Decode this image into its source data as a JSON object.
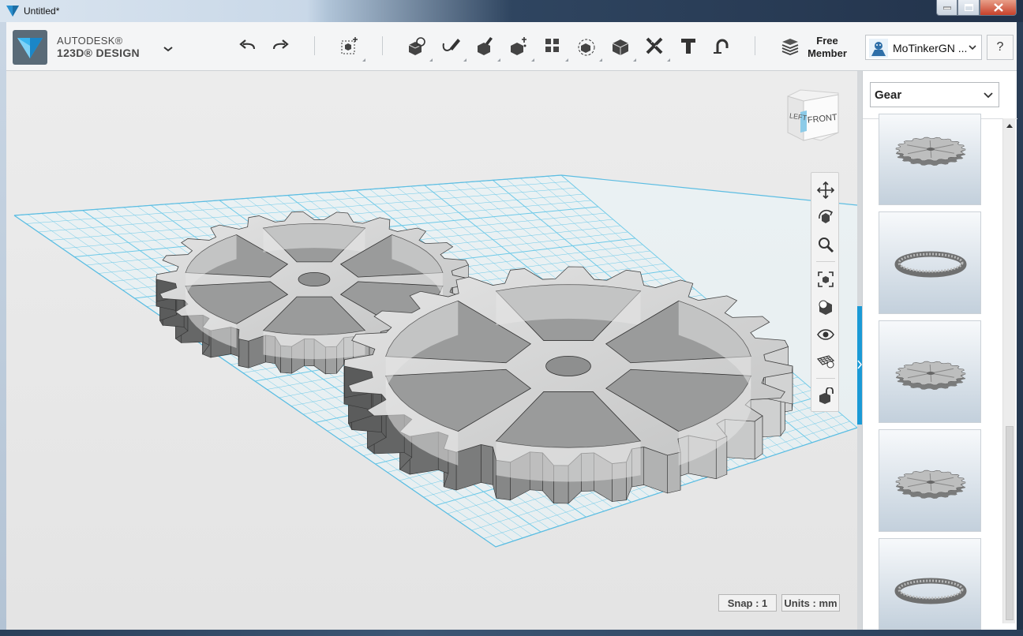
{
  "window": {
    "title": "Untitled*"
  },
  "brand": {
    "line1": "AUTODESK®",
    "line2": "123D® DESIGN"
  },
  "toolbar": {
    "icons": [
      "undo-icon",
      "redo-icon",
      "transform-icon",
      "primitives-icon",
      "sketch-icon",
      "construct-icon",
      "modify-icon",
      "pattern-icon",
      "group-icon",
      "combine-icon",
      "measure-icon",
      "text-icon",
      "snap-icon",
      "material-icon"
    ]
  },
  "account": {
    "membership": "Free\nMember",
    "membership_l1": "Free",
    "membership_l2": "Member",
    "username": "MoTinkerGN ...",
    "help": "?"
  },
  "viewcube": {
    "left": "LEFT",
    "front": "FRONT"
  },
  "navbar": {
    "icons": [
      "pan-icon",
      "orbit-icon",
      "zoom-icon",
      "fit-icon",
      "view-icon",
      "visibility-icon",
      "grid-icon",
      "material-icon"
    ]
  },
  "status": {
    "snap": "Snap : 1",
    "units": "Units : mm"
  },
  "panel": {
    "category": "Gear",
    "thumbnails": [
      "gear-1",
      "ring-1",
      "gear-2",
      "gear-3",
      "ring-2"
    ]
  },
  "colors": {
    "accent": "#1a9ad6",
    "grid": "#6cc9e8",
    "gear": "#cfd0d0"
  }
}
